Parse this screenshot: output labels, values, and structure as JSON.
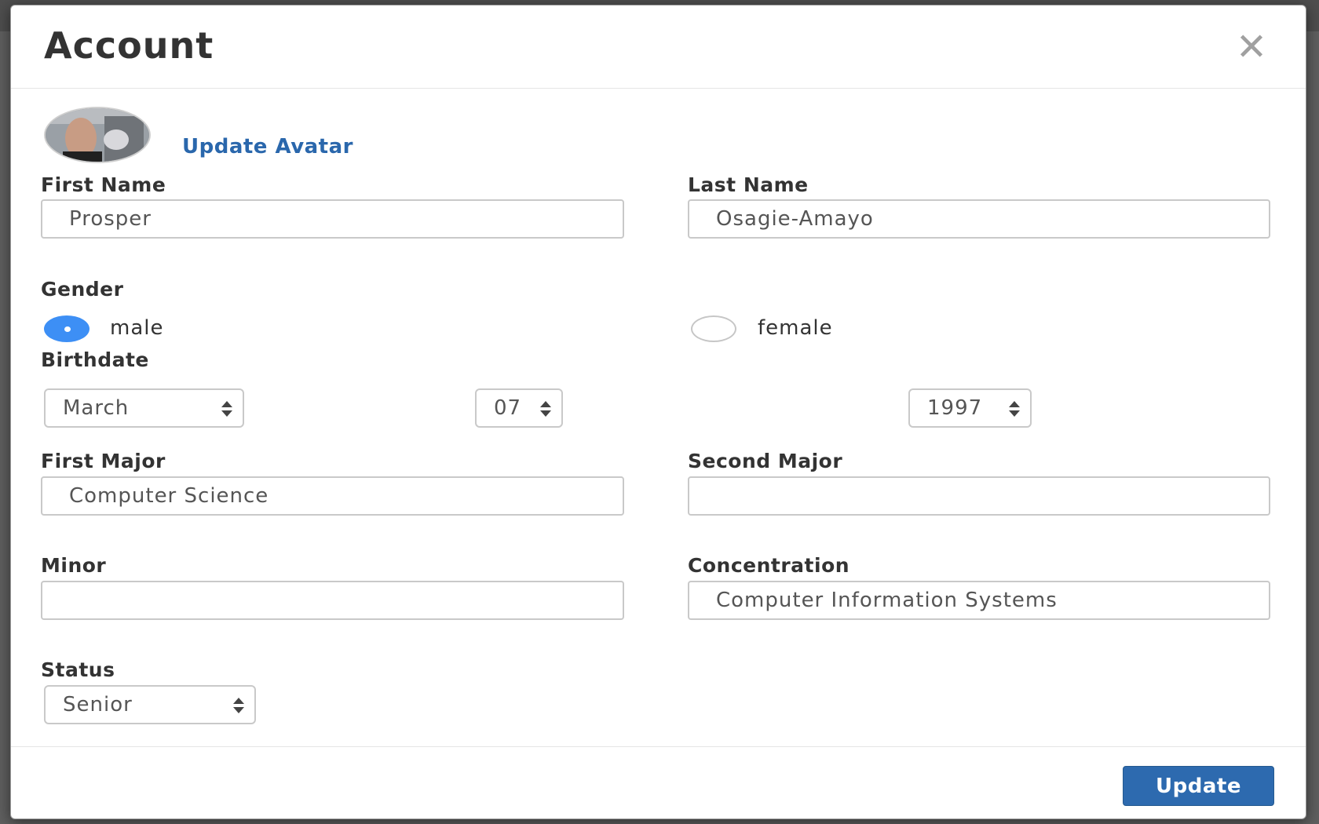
{
  "modal": {
    "title": "Account",
    "close_icon": "close-icon"
  },
  "avatar": {
    "icon": "avatar-photo",
    "update_link": "Update Avatar"
  },
  "form": {
    "first_name": {
      "label": "First Name",
      "value": "Prosper"
    },
    "last_name": {
      "label": "Last Name",
      "value": "Osagie-Amayo"
    },
    "gender": {
      "label": "Gender",
      "options": [
        {
          "label": "male",
          "checked": true
        },
        {
          "label": "female",
          "checked": false
        }
      ]
    },
    "birthdate": {
      "label": "Birthdate",
      "month": "March",
      "day": "07",
      "year": "1997"
    },
    "first_major": {
      "label": "First Major",
      "value": "Computer Science"
    },
    "second_major": {
      "label": "Second Major",
      "value": ""
    },
    "minor": {
      "label": "Minor",
      "value": ""
    },
    "concentration": {
      "label": "Concentration",
      "value": "Computer Information Systems"
    },
    "status": {
      "label": "Status",
      "value": "Senior"
    }
  },
  "footer": {
    "update_label": "Update"
  },
  "colors": {
    "primary": "#2d6aaf",
    "link": "#2a67ac",
    "radio_checked": "#3d8ff5"
  }
}
